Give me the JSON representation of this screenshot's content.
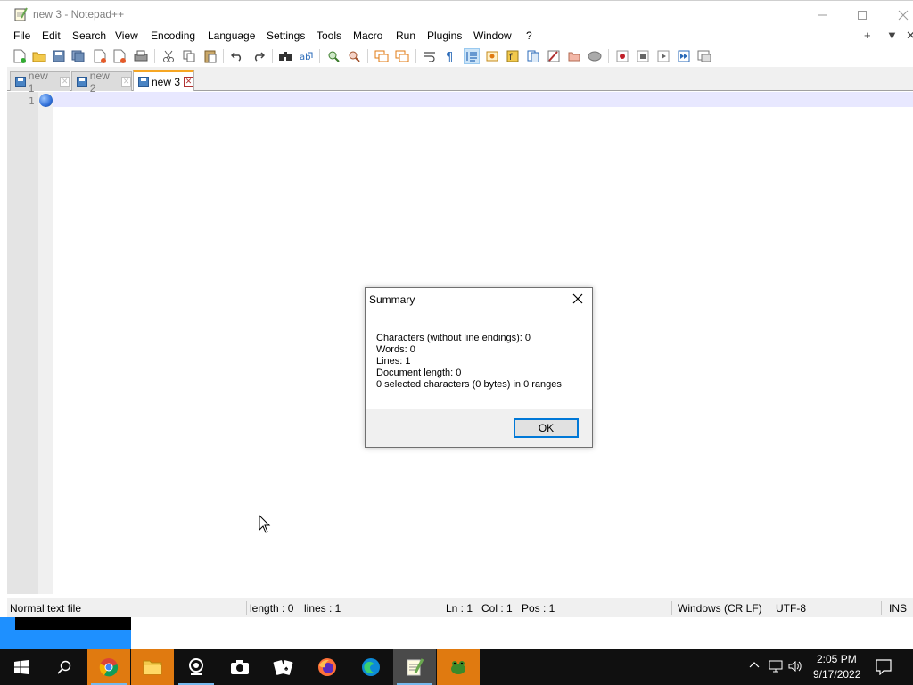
{
  "window": {
    "title": "new 3 - Notepad++",
    "controls": [
      "minimize-icon",
      "maximize-icon",
      "close-icon"
    ]
  },
  "menu": {
    "items": [
      "File",
      "Edit",
      "Search",
      "View",
      "Encoding",
      "Language",
      "Settings",
      "Tools",
      "Macro",
      "Run",
      "Plugins",
      "Window",
      "?"
    ],
    "right": [
      "+",
      "▼",
      "✕"
    ]
  },
  "toolbar": {
    "icons": [
      "new-file-icon",
      "open-file-icon",
      "save-icon",
      "save-all-icon",
      "close-icon",
      "close-all-icon",
      "print-icon",
      "cut-icon",
      "copy-icon",
      "paste-icon",
      "undo-icon",
      "redo-icon",
      "find-icon",
      "replace-icon",
      "zoom-in-icon",
      "zoom-out-icon",
      "sync-vertical-icon",
      "sync-horizontal-icon",
      "word-wrap-icon",
      "show-all-chars-icon",
      "indent-guide-icon",
      "function-list-icon",
      "doc-map-icon",
      "folder-workspace-icon",
      "monitoring-icon",
      "record-macro-icon",
      "stop-macro-icon",
      "play-macro-icon",
      "run-macro-multiple-icon",
      "save-macro-icon"
    ]
  },
  "tabs": [
    {
      "label": "new 1",
      "active": false
    },
    {
      "label": "new 2",
      "active": false
    },
    {
      "label": "new 3",
      "active": true
    }
  ],
  "editor": {
    "line_number": "1",
    "content": ""
  },
  "statusbar": {
    "file_type": "Normal text file",
    "length": "length : 0",
    "lines": "lines : 1",
    "ln": "Ln : 1",
    "col": "Col : 1",
    "pos": "Pos : 1",
    "eol": "Windows (CR LF)",
    "encoding": "UTF-8",
    "mode": "INS"
  },
  "dialog": {
    "title": "Summary",
    "lines": [
      "Characters (without line endings): 0",
      "Words: 0",
      "Lines: 1",
      "Document length: 0",
      "0 selected characters (0 bytes) in 0 ranges"
    ],
    "ok_label": "OK"
  },
  "taskbar": {
    "apps": [
      "windows-start-icon",
      "search-icon",
      "chrome-icon",
      "file-explorer-icon",
      "webcam-icon",
      "camera-icon",
      "solitaire-icon",
      "firefox-icon",
      "edge-icon",
      "notepadpp-icon",
      "frogger-icon"
    ],
    "clock_time": "2:05 PM",
    "clock_date": "9/17/2022"
  },
  "colors": {
    "tab_accent": "#f6a623",
    "current_line": "#e8e8ff",
    "ok_border": "#0078d7",
    "taskbar": "#101010"
  }
}
